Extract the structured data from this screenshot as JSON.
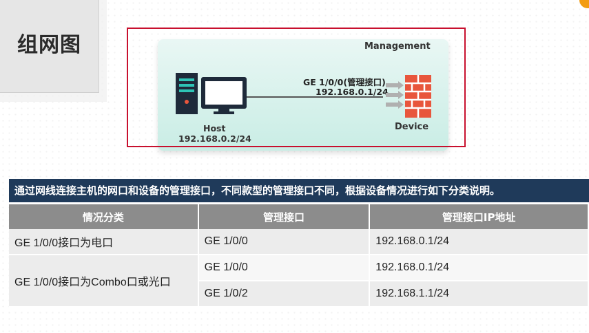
{
  "page": {
    "title": "组网图"
  },
  "diagram": {
    "management_label": "Management",
    "port_label": "GE 1/0/0(管理接口)",
    "device_ip": "192.168.0.1/24",
    "host_label": "Host",
    "host_ip": "192.168.0.2/24",
    "device_label": "Device",
    "icons": [
      "computer-icon",
      "firewall-icon",
      "arrow-icon"
    ]
  },
  "banner": {
    "text": "通过网线连接主机的网口和设备的管理接口，不同款型的管理接口不同，根据设备情况进行如下分类说明。"
  },
  "table": {
    "headers": [
      "情况分类",
      "管理接口",
      "管理接口IP地址"
    ],
    "rows": [
      {
        "category": "GE 1/0/0接口为电口",
        "interface": "GE 1/0/0",
        "ip": "192.168.0.1/24"
      },
      {
        "category": "GE 1/0/0接口为Combo口或光口",
        "interface": "GE 1/0/0",
        "ip": "192.168.0.1/24"
      },
      {
        "category": "",
        "interface": "GE 1/0/2",
        "ip": "192.168.1.1/24"
      }
    ]
  },
  "colors": {
    "frame": "#c8102e",
    "banner": "#1f3a5a",
    "header": "#8c8c8c",
    "firewall": "#e8563c",
    "accent": "#f39c12"
  }
}
